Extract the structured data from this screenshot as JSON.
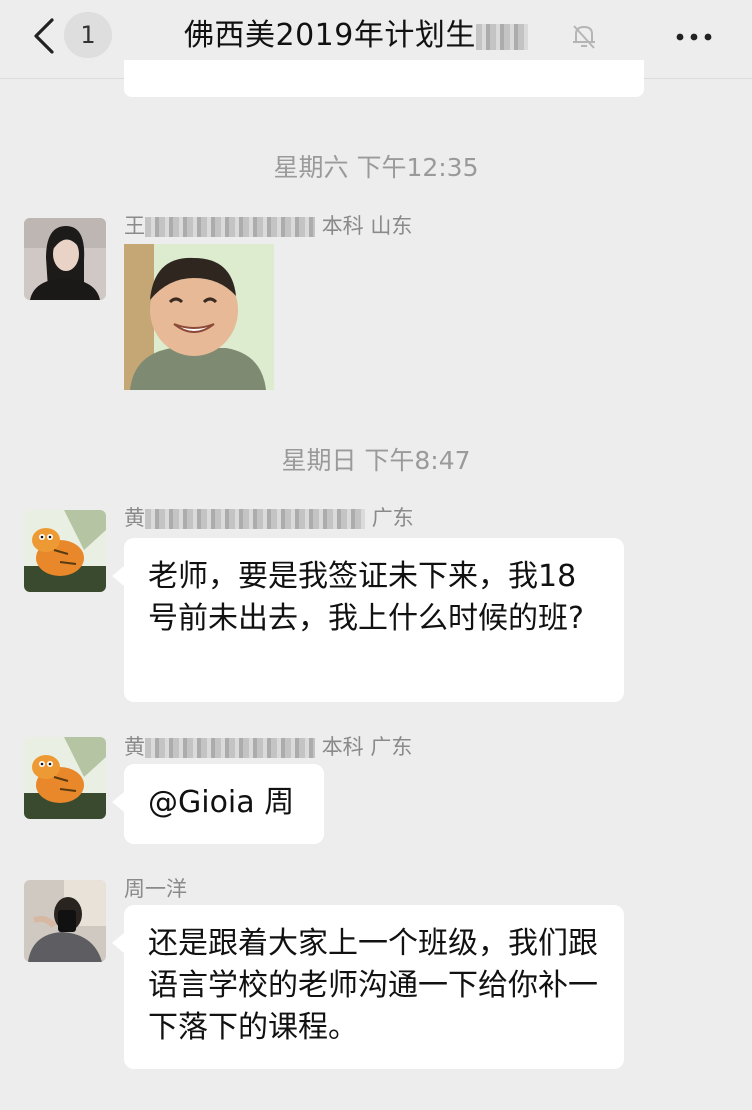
{
  "nav": {
    "back_count": "1",
    "title": "佛西美2019年计划生",
    "more_label": "•••"
  },
  "timestamps": [
    "星期六 下午12:35",
    "星期日 下午8:47"
  ],
  "messages": [
    {
      "sender": "王 本科 山东",
      "sender_prefix": "王",
      "sender_suffix": "本科 山东",
      "type": "sticker"
    },
    {
      "sender_prefix": "黄",
      "sender_suffix": "广东",
      "text": "老师，要是我签证未下来，我18号前未出去，我上什么时候的班?"
    },
    {
      "sender_prefix": "黄",
      "sender_suffix": "本科 广东",
      "text": "@Gioia 周"
    },
    {
      "sender": "周一洋",
      "text": "还是跟着大家上一个班级，我们跟语言学校的老师沟通一下给你补一下落下的课程。"
    }
  ],
  "icons": {
    "back": "chevron-left-icon",
    "mute": "bell-mute-icon",
    "more": "more-dots-icon"
  }
}
